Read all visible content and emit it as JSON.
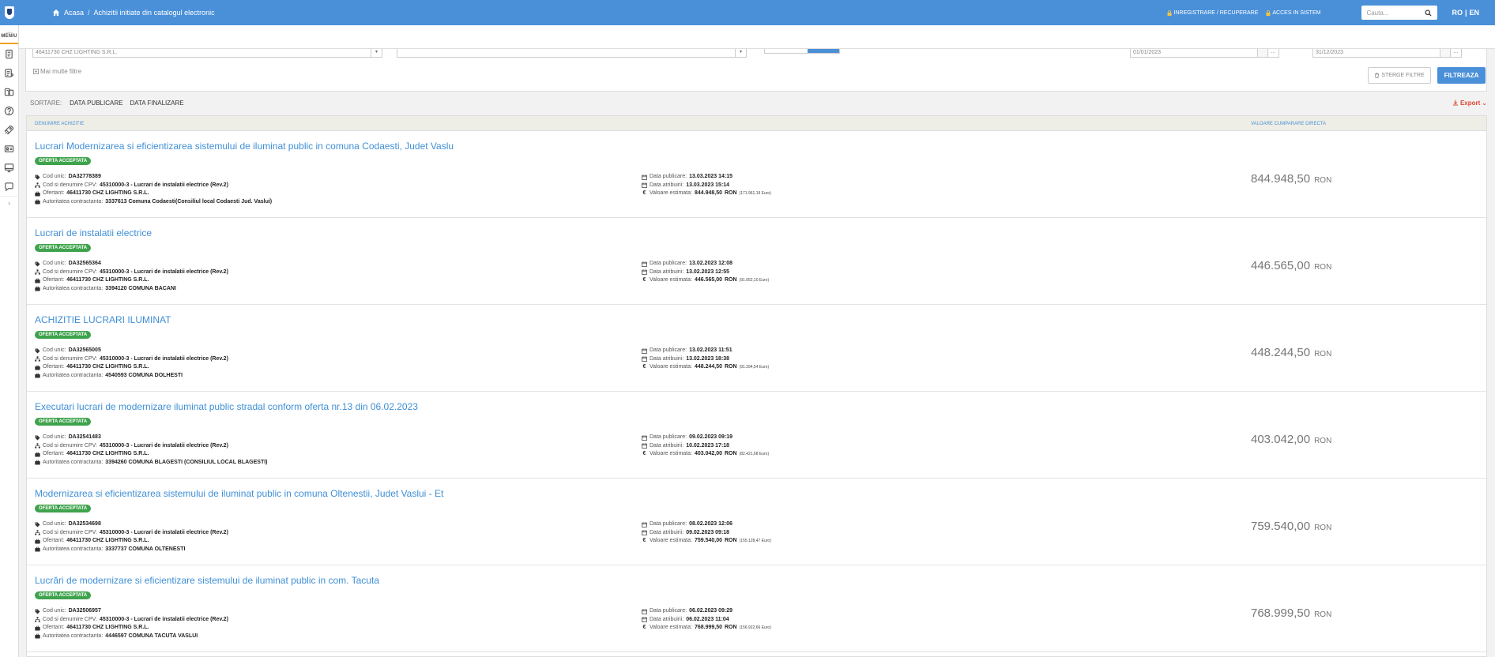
{
  "rail": {
    "menu_tiny": "meniu",
    "menu_label": "MENIU",
    "icons": [
      "document-icon",
      "list-edit-icon",
      "catalog-icon",
      "help-icon",
      "rocket-icon",
      "id-card-icon",
      "monitor-icon",
      "chat-icon"
    ],
    "expand": "›"
  },
  "header": {
    "breadcrumb": {
      "home": "Acasa",
      "separator": "/",
      "current": "Achizitii initiate din catalogul electronic"
    },
    "register_link": "INREGISTRARE / RECUPERARE",
    "login_link": "ACCES IN SISTEM",
    "search_placeholder": "Cauta...",
    "lang_ro": "RO",
    "lang_sep": "|",
    "lang_en": "EN"
  },
  "filters": {
    "supplier_value": "46411730 CHZ LIGHTING S.R.L.",
    "date_from": "01/01/2023",
    "date_to": "31/12/2023",
    "more_filters": "Mai multe filtre",
    "clear_button": "STERGE FILTRE",
    "filter_button": "FILTREAZA"
  },
  "sort": {
    "label": "SORTARE:",
    "options": [
      "DATA PUBLICARE",
      "DATA FINALIZARE"
    ],
    "export": "Export"
  },
  "table": {
    "col_name": "DENUMIRE ACHIZITIE",
    "col_value": "VALOARE CUMPARARE DIRECTA",
    "labels": {
      "code": "Cod unic:",
      "cpv": "Cod si denumire CPV:",
      "bidder": "Ofertant:",
      "authority": "Autoritatea contractanta:",
      "published": "Data publicare:",
      "awarded": "Data atribuirii:",
      "estimated": "Valoare estimata:",
      "currency": "RON",
      "euro_suffix": "Euro"
    },
    "rows": [
      {
        "title": "Lucrari Modernizarea si eficientizarea sistemului de iluminat public in comuna Codaesti, Judet Vaslu",
        "status": "OFERTA ACCEPTATA",
        "code": "DA32778389",
        "cpv": "45310000-3 - Lucrari de instalatii electrice (Rev.2)",
        "bidder": "46411730 CHZ LIGHTING S.R.L.",
        "authority": "3337613 Comuna Codaesti(Consiliul local Codaesti Jud. Vaslui)",
        "published": "13.03.2023 14:15",
        "awarded": "13.03.2023 15:14",
        "estimated": "844.948,50",
        "estimated_eur": "(171.961,19",
        "price": "844.948,50",
        "price_currency": "RON"
      },
      {
        "title": "Lucrari de instalatii electrice",
        "status": "OFERTA ACCEPTATA",
        "code": "DA32565364",
        "cpv": "45310000-3 - Lucrari de instalatii electrice (Rev.2)",
        "bidder": "46411730 CHZ LIGHTING S.R.L.",
        "authority": "3394120 COMUNA BACANI",
        "published": "13.02.2023 12:08",
        "awarded": "13.02.2023 12:55",
        "estimated": "446.565,00",
        "estimated_eur": "(91.052,10",
        "price": "446.565,00",
        "price_currency": "RON"
      },
      {
        "title": "ACHIZITIE LUCRARI ILUMINAT",
        "status": "OFERTA ACCEPTATA",
        "code": "DA32565005",
        "cpv": "45310000-3 - Lucrari de instalatii electrice (Rev.2)",
        "bidder": "46411730 CHZ LIGHTING S.R.L.",
        "authority": "4540593 COMUNA DOLHESTI",
        "published": "13.02.2023 11:51",
        "awarded": "13.02.2023 18:38",
        "estimated": "448.244,50",
        "estimated_eur": "(91.394,54",
        "price": "448.244,50",
        "price_currency": "RON"
      },
      {
        "title": "Executari lucrari de modernizare iluminat public stradal conform oferta nr.13 din 06.02.2023",
        "status": "OFERTA ACCEPTATA",
        "code": "DA32541483",
        "cpv": "45310000-3 - Lucrari de instalatii electrice (Rev.2)",
        "bidder": "46411730 CHZ LIGHTING S.R.L.",
        "authority": "3394260 COMUNA BLAGESTI (CONSILIUL LOCAL BLAGESTI)",
        "published": "09.02.2023 09:19",
        "awarded": "10.02.2023 17:18",
        "estimated": "403.042,00",
        "estimated_eur": "(82.421,68",
        "price": "403.042,00",
        "price_currency": "RON"
      },
      {
        "title": "Modernizarea si eficientizarea sistemului de iluminat public in comuna Oltenestii, Judet Vaslui - Et",
        "status": "OFERTA ACCEPTATA",
        "code": "DA32534698",
        "cpv": "45310000-3 - Lucrari de instalatii electrice (Rev.2)",
        "bidder": "46411730 CHZ LIGHTING S.R.L.",
        "authority": "3337737 COMUNA OLTENESTI",
        "published": "08.02.2023 12:06",
        "awarded": "09.02.2023 09:18",
        "estimated": "759.540,00",
        "estimated_eur": "(155.128,47",
        "price": "759.540,00",
        "price_currency": "RON"
      },
      {
        "title": "Lucrări de modernizare si eficientizare sistemului de iluminat public in com. Tacuta",
        "status": "OFERTA ACCEPTATA",
        "code": "DA32506957",
        "cpv": "45310000-3 - Lucrari de instalatii electrice (Rev.2)",
        "bidder": "46411730 CHZ LIGHTING S.R.L.",
        "authority": "4446597 COMUNA TACUTA VASLUI",
        "published": "06.02.2023 09:29",
        "awarded": "06.02.2023 11:04",
        "estimated": "768.999,50",
        "estimated_eur": "(156.922,66",
        "price": "768.999,50",
        "price_currency": "RON"
      }
    ]
  },
  "colors": {
    "brand_blue": "#4a90d9",
    "link_blue": "#3f8fd6",
    "status_green": "#3fa34d",
    "export_red": "#e0452f",
    "menu_accent": "#f0a020"
  }
}
